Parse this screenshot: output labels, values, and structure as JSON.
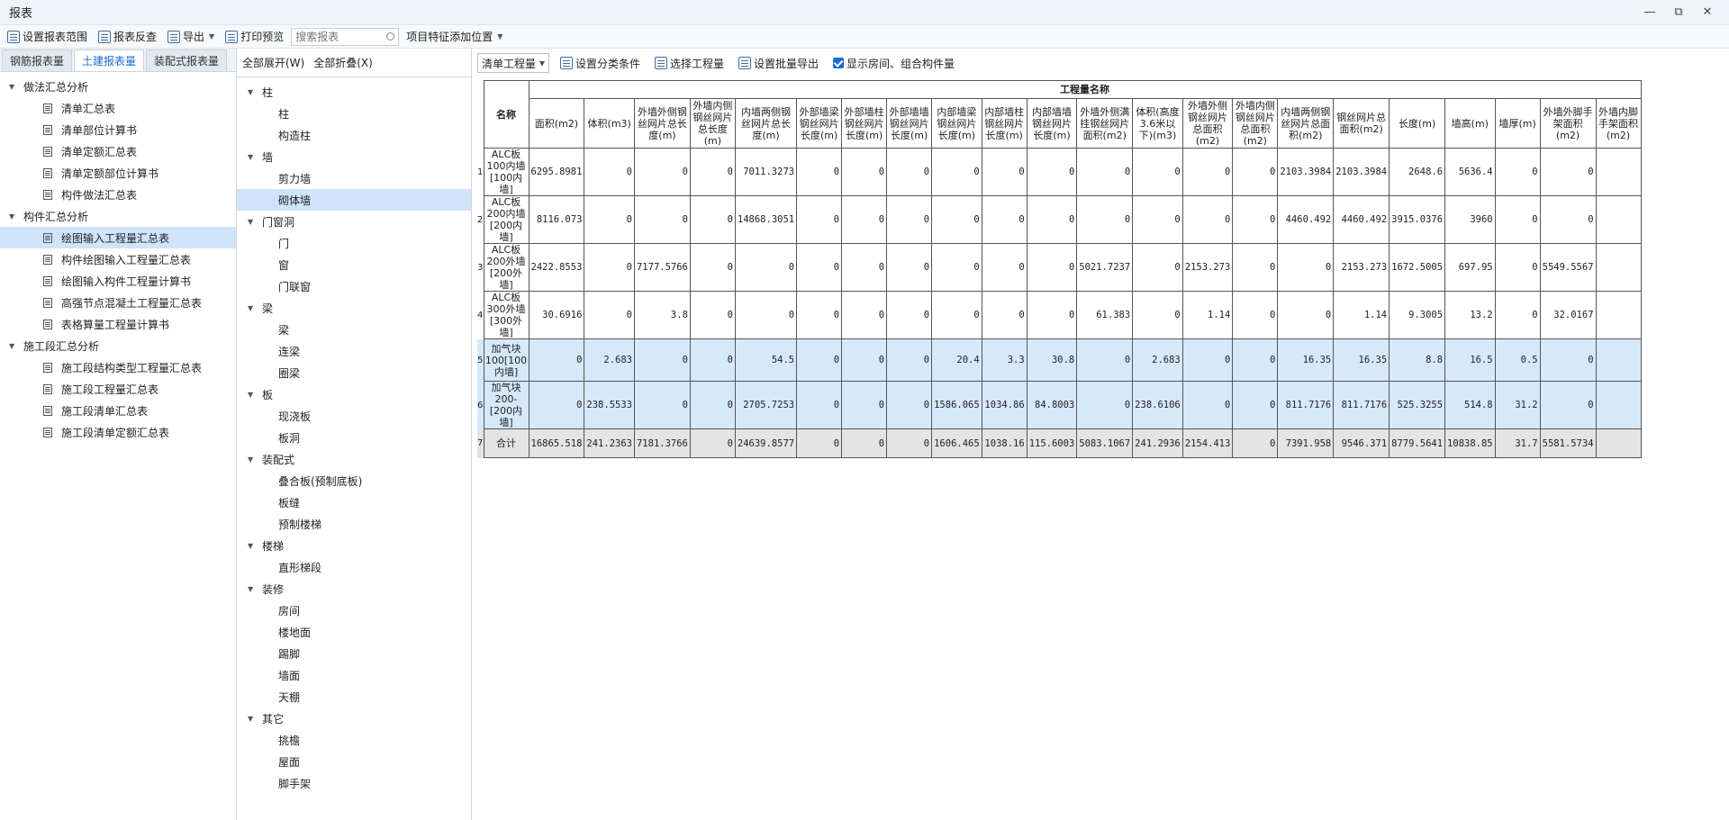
{
  "window": {
    "title": "报表",
    "min": "—",
    "restore": "⧉",
    "close": "✕"
  },
  "toolbar": {
    "set_range": "设置报表范围",
    "review": "报表反查",
    "export": "导出",
    "print_preview": "打印预览",
    "search_placeholder": "搜索报表",
    "add_feature": "项目特征添加位置"
  },
  "tabs": [
    "钢筋报表量",
    "土建报表量",
    "装配式报表量"
  ],
  "left_tree": [
    {
      "label": "做法汇总分析",
      "children": [
        "清单汇总表",
        "清单部位计算书",
        "清单定额汇总表",
        "清单定额部位计算书",
        "构件做法汇总表"
      ]
    },
    {
      "label": "构件汇总分析",
      "children": [
        "绘图输入工程量汇总表",
        "构件绘图输入工程量汇总表",
        "绘图输入构件工程量计算书",
        "高强节点混凝土工程量汇总表",
        "表格算量工程量计算书"
      ]
    },
    {
      "label": "施工段汇总分析",
      "children": [
        "施工段结构类型工程量汇总表",
        "施工段工程量汇总表",
        "施工段清单汇总表",
        "施工段清单定额汇总表"
      ]
    }
  ],
  "mid": {
    "expand_all": "全部展开(W)",
    "collapse_all": "全部折叠(X)",
    "tree": [
      {
        "label": "柱",
        "children": [
          "柱",
          "构造柱"
        ]
      },
      {
        "label": "墙",
        "children": [
          "剪力墙",
          "砌体墙"
        ]
      },
      {
        "label": "门窗洞",
        "children": [
          "门",
          "窗",
          "门联窗"
        ]
      },
      {
        "label": "梁",
        "children": [
          "梁",
          "连梁",
          "圈梁"
        ]
      },
      {
        "label": "板",
        "children": [
          "现浇板",
          "板洞"
        ]
      },
      {
        "label": "装配式",
        "children": [
          "叠合板(预制底板)",
          "板缝",
          "预制楼梯"
        ]
      },
      {
        "label": "楼梯",
        "children": [
          "直形梯段"
        ]
      },
      {
        "label": "装修",
        "children": [
          "房间",
          "楼地面",
          "踢脚",
          "墙面",
          "天棚"
        ]
      },
      {
        "label": "其它",
        "children": [
          "挑檐",
          "屋面",
          "脚手架"
        ]
      }
    ]
  },
  "right_bar": {
    "dropdown": "清单工程量",
    "set_category": "设置分类条件",
    "select_quantity": "选择工程量",
    "batch_export": "设置批量导出",
    "show_rooms": "显示房间、组合构件量"
  },
  "table": {
    "group_header": "工程量名称",
    "name_header": "名称",
    "columns": [
      "面积(m2)",
      "体积(m3)",
      "外墙外侧钢丝网片总长度(m)",
      "外墙内侧钢丝网片总长度(m)",
      "内墙两侧钢丝网片总长度(m)",
      "外部墙梁钢丝网片长度(m)",
      "外部墙柱钢丝网片长度(m)",
      "外部墙墙钢丝网片长度(m)",
      "内部墙梁钢丝网片长度(m)",
      "内部墙柱钢丝网片长度(m)",
      "内部墙墙钢丝网片长度(m)",
      "外墙外侧满挂钢丝网片面积(m2)",
      "体积(高度3.6米以下)(m3)",
      "外墙外侧钢丝网片总面积(m2)",
      "外墙内侧钢丝网片总面积(m2)",
      "内墙两侧钢丝网片总面积(m2)",
      "钢丝网片总面积(m2)",
      "长度(m)",
      "墙高(m)",
      "墙厚(m)",
      "外墙外脚手架面积(m2)",
      "外墙内脚手架面积(m2)"
    ],
    "rows": [
      {
        "idx": "1",
        "name": "ALC板100内墙[100内墙]",
        "values": [
          "6295.8981",
          "0",
          "0",
          "0",
          "7011.3273",
          "0",
          "0",
          "0",
          "0",
          "0",
          "0",
          "0",
          "0",
          "0",
          "0",
          "2103.3984",
          "2103.3984",
          "2648.6",
          "5636.4",
          "0",
          "0",
          ""
        ]
      },
      {
        "idx": "2",
        "name": "ALC板200内墙[200内墙]",
        "values": [
          "8116.073",
          "0",
          "0",
          "0",
          "14868.3051",
          "0",
          "0",
          "0",
          "0",
          "0",
          "0",
          "0",
          "0",
          "0",
          "0",
          "4460.492",
          "4460.492",
          "3915.0376",
          "3960",
          "0",
          "0",
          ""
        ]
      },
      {
        "idx": "3",
        "name": "ALC板200外墙[200外墙]",
        "values": [
          "2422.8553",
          "0",
          "7177.5766",
          "0",
          "0",
          "0",
          "0",
          "0",
          "0",
          "0",
          "0",
          "5021.7237",
          "0",
          "2153.273",
          "0",
          "0",
          "2153.273",
          "1672.5005",
          "697.95",
          "0",
          "5549.5567",
          ""
        ]
      },
      {
        "idx": "4",
        "name": "ALC板300外墙[300外墙]",
        "values": [
          "30.6916",
          "0",
          "3.8",
          "0",
          "0",
          "0",
          "0",
          "0",
          "0",
          "0",
          "0",
          "61.383",
          "0",
          "1.14",
          "0",
          "0",
          "1.14",
          "9.3005",
          "13.2",
          "0",
          "32.0167",
          ""
        ]
      },
      {
        "idx": "5",
        "name": "加气块 100[100内墙]",
        "values": [
          "0",
          "2.683",
          "0",
          "0",
          "54.5",
          "0",
          "0",
          "0",
          "20.4",
          "3.3",
          "30.8",
          "0",
          "2.683",
          "0",
          "0",
          "16.35",
          "16.35",
          "8.8",
          "16.5",
          "0.5",
          "0",
          ""
        ]
      },
      {
        "idx": "6",
        "name": "加气块 200-[200内墙]",
        "values": [
          "0",
          "238.5533",
          "0",
          "0",
          "2705.7253",
          "0",
          "0",
          "0",
          "1586.065",
          "1034.86",
          "84.8003",
          "0",
          "238.6106",
          "0",
          "0",
          "811.7176",
          "811.7176",
          "525.3255",
          "514.8",
          "31.2",
          "0",
          ""
        ]
      },
      {
        "idx": "7",
        "name": "合计",
        "values": [
          "16865.518",
          "241.2363",
          "7181.3766",
          "0",
          "24639.8577",
          "0",
          "0",
          "0",
          "1606.465",
          "1038.16",
          "115.6003",
          "5083.1067",
          "241.2936",
          "2154.413",
          "0",
          "7391.958",
          "9546.371",
          "8779.5641",
          "10838.85",
          "31.7",
          "5581.5734",
          ""
        ]
      }
    ]
  }
}
